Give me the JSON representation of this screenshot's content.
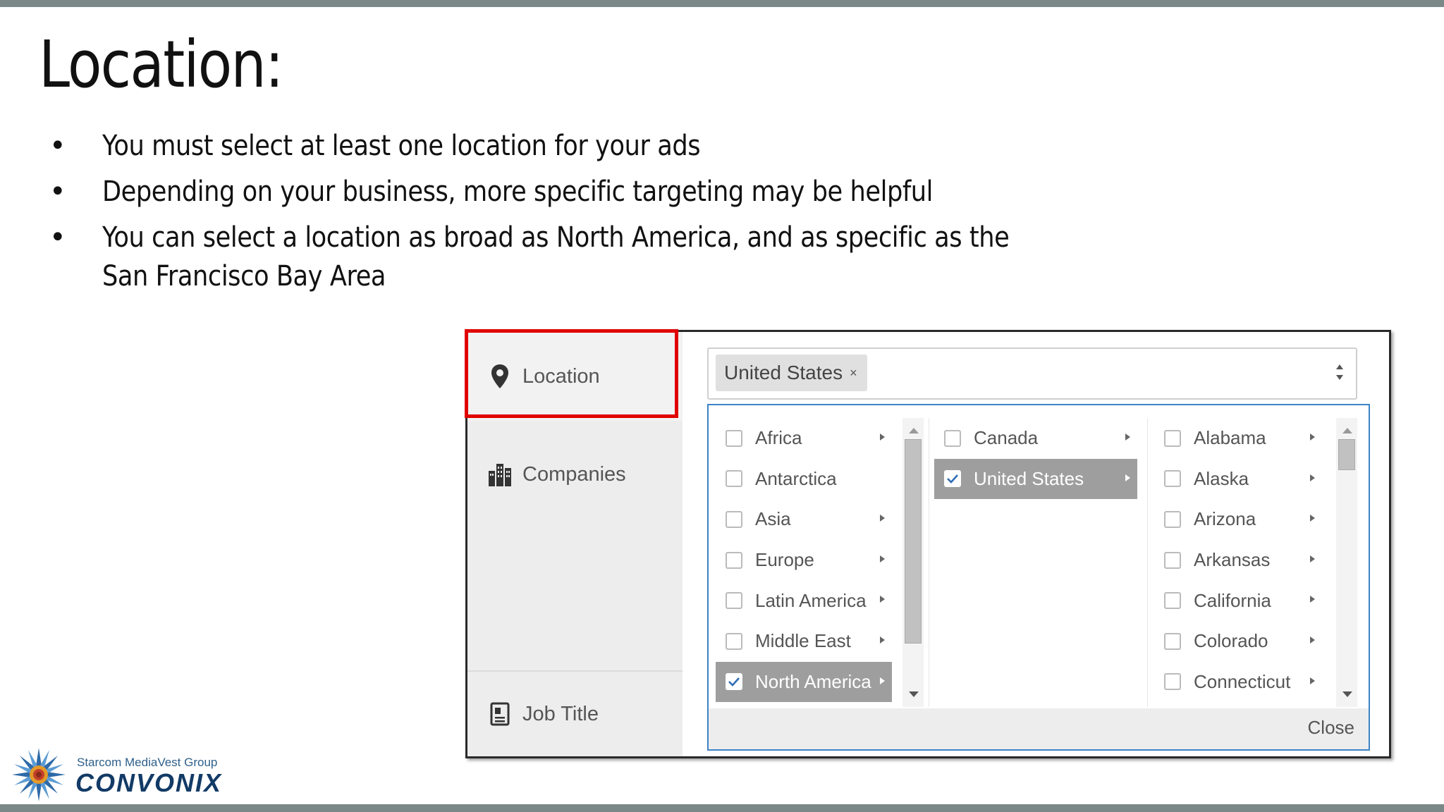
{
  "slide": {
    "title": "Location:",
    "bullets": [
      "You must select at least one location for your ads",
      "Depending on your business, more specific targeting may be helpful",
      "You can select a location as broad as North America, and as specific as the San Francisco Bay Area"
    ],
    "bullet_glyph": "•"
  },
  "nav": {
    "location": "Location",
    "companies": "Companies",
    "job_title": "Job Title",
    "icons": [
      "map-pin-icon",
      "building-icon",
      "id-badge-icon"
    ]
  },
  "select": {
    "chip_label": "United States",
    "chip_remove": "×"
  },
  "dropdown": {
    "regions": [
      {
        "label": "Africa",
        "arrow": true,
        "checked": false
      },
      {
        "label": "Antarctica",
        "arrow": false,
        "checked": false
      },
      {
        "label": "Asia",
        "arrow": true,
        "checked": false
      },
      {
        "label": "Europe",
        "arrow": true,
        "checked": false
      },
      {
        "label": "Latin America",
        "arrow": true,
        "checked": false
      },
      {
        "label": "Middle East",
        "arrow": true,
        "checked": false
      },
      {
        "label": "North America",
        "arrow": true,
        "checked": true
      }
    ],
    "countries": [
      {
        "label": "Canada",
        "arrow": true,
        "checked": false
      },
      {
        "label": "United States",
        "arrow": true,
        "checked": true
      }
    ],
    "states": [
      {
        "label": "Alabama",
        "arrow": true,
        "checked": false
      },
      {
        "label": "Alaska",
        "arrow": true,
        "checked": false
      },
      {
        "label": "Arizona",
        "arrow": true,
        "checked": false
      },
      {
        "label": "Arkansas",
        "arrow": true,
        "checked": false
      },
      {
        "label": "California",
        "arrow": true,
        "checked": false
      },
      {
        "label": "Colorado",
        "arrow": true,
        "checked": false
      },
      {
        "label": "Connecticut",
        "arrow": true,
        "checked": false
      }
    ],
    "close_label": "Close"
  },
  "logo": {
    "tagline": "Starcom MediaVest Group",
    "name": "CONVONIX"
  },
  "colors": {
    "accent_bar": "#7a8987",
    "highlight_box": "#e00000",
    "dropdown_border": "#3d84c6",
    "selected_row": "#9e9e9e"
  }
}
